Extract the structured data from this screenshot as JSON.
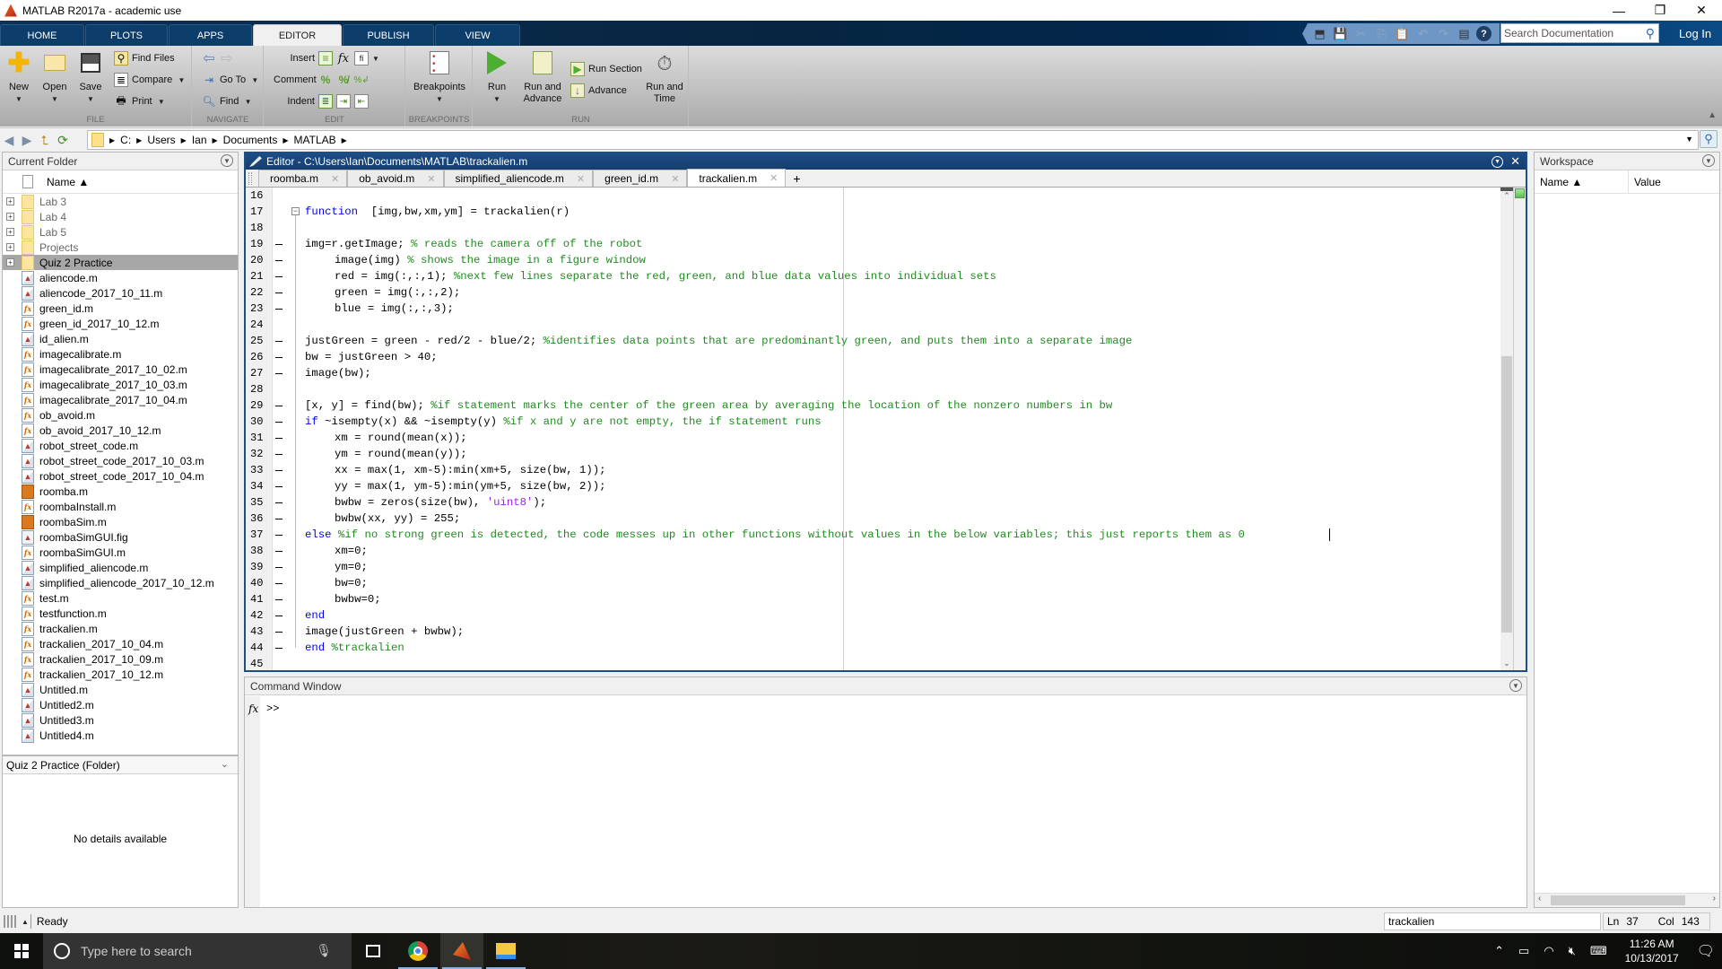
{
  "window": {
    "title": "MATLAB R2017a - academic use",
    "controls": {
      "minimize": "—",
      "restore": "❐",
      "close": "✕"
    }
  },
  "ribbon_tabs": [
    {
      "label": "HOME",
      "active": false
    },
    {
      "label": "PLOTS",
      "active": false
    },
    {
      "label": "APPS",
      "active": false
    },
    {
      "label": "EDITOR",
      "active": true
    },
    {
      "label": "PUBLISH",
      "active": false
    },
    {
      "label": "VIEW",
      "active": false
    }
  ],
  "quick_access": {
    "icons": [
      "new-simulink-icon",
      "save-icon",
      "cut-icon",
      "copy-icon",
      "paste-icon",
      "undo-icon",
      "redo-icon",
      "switch-windows-icon",
      "help-icon"
    ],
    "search_placeholder": "Search Documentation",
    "login_label": "Log In"
  },
  "ribbon": {
    "file": {
      "group_label": "FILE",
      "new": "New",
      "open": "Open",
      "save": "Save",
      "find_files": "Find Files",
      "compare": "Compare",
      "print": "Print"
    },
    "navigate": {
      "group_label": "NAVIGATE",
      "goto": "Go To",
      "find": "Find"
    },
    "edit": {
      "group_label": "EDIT",
      "insert": "Insert",
      "comment": "Comment",
      "indent": "Indent"
    },
    "breakpoints": {
      "group_label": "BREAKPOINTS",
      "breakpoints": "Breakpoints"
    },
    "run": {
      "group_label": "RUN",
      "run": "Run",
      "run_and_advance_1": "Run and",
      "run_and_advance_2": "Advance",
      "run_section": "Run Section",
      "advance": "Advance",
      "run_and_time_1": "Run and",
      "run_and_time_2": "Time"
    }
  },
  "address_bar": {
    "path": [
      "C:",
      "Users",
      "Ian",
      "Documents",
      "MATLAB"
    ]
  },
  "current_folder": {
    "title": "Current Folder",
    "column_name": "Name ▲",
    "items": [
      {
        "name": "Lab 3",
        "type": "folder"
      },
      {
        "name": "Lab 4",
        "type": "folder"
      },
      {
        "name": "Lab 5",
        "type": "folder"
      },
      {
        "name": "Projects",
        "type": "folder"
      },
      {
        "name": "Quiz 2 Practice",
        "type": "folder",
        "selected": true
      },
      {
        "name": "aliencode.m",
        "type": "script"
      },
      {
        "name": "aliencode_2017_10_11.m",
        "type": "script"
      },
      {
        "name": "green_id.m",
        "type": "function"
      },
      {
        "name": "green_id_2017_10_12.m",
        "type": "function"
      },
      {
        "name": "id_alien.m",
        "type": "script"
      },
      {
        "name": "imagecalibrate.m",
        "type": "function"
      },
      {
        "name": "imagecalibrate_2017_10_02.m",
        "type": "function"
      },
      {
        "name": "imagecalibrate_2017_10_03.m",
        "type": "function"
      },
      {
        "name": "imagecalibrate_2017_10_04.m",
        "type": "function"
      },
      {
        "name": "ob_avoid.m",
        "type": "function"
      },
      {
        "name": "ob_avoid_2017_10_12.m",
        "type": "function"
      },
      {
        "name": "robot_street_code.m",
        "type": "script"
      },
      {
        "name": "robot_street_code_2017_10_03.m",
        "type": "script"
      },
      {
        "name": "robot_street_code_2017_10_04.m",
        "type": "script"
      },
      {
        "name": "roomba.m",
        "type": "class"
      },
      {
        "name": "roombaInstall.m",
        "type": "function"
      },
      {
        "name": "roombaSim.m",
        "type": "class"
      },
      {
        "name": "roombaSimGUI.fig",
        "type": "figure"
      },
      {
        "name": "roombaSimGUI.m",
        "type": "function"
      },
      {
        "name": "simplified_aliencode.m",
        "type": "script"
      },
      {
        "name": "simplified_aliencode_2017_10_12.m",
        "type": "script"
      },
      {
        "name": "test.m",
        "type": "function"
      },
      {
        "name": "testfunction.m",
        "type": "function"
      },
      {
        "name": "trackalien.m",
        "type": "function"
      },
      {
        "name": "trackalien_2017_10_04.m",
        "type": "function"
      },
      {
        "name": "trackalien_2017_10_09.m",
        "type": "function"
      },
      {
        "name": "trackalien_2017_10_12.m",
        "type": "function"
      },
      {
        "name": "Untitled.m",
        "type": "script"
      },
      {
        "name": "Untitled2.m",
        "type": "script"
      },
      {
        "name": "Untitled3.m",
        "type": "script"
      },
      {
        "name": "Untitled4.m",
        "type": "script"
      }
    ],
    "details_title": "Quiz 2 Practice  (Folder)",
    "details_text": "No details available"
  },
  "editor": {
    "title": "Editor - C:\\Users\\Ian\\Documents\\MATLAB\\trackalien.m",
    "tabs": [
      {
        "label": "roomba.m",
        "active": false
      },
      {
        "label": "ob_avoid.m",
        "active": false
      },
      {
        "label": "simplified_aliencode.m",
        "active": false
      },
      {
        "label": "green_id.m",
        "active": false
      },
      {
        "label": "trackalien.m",
        "active": true
      }
    ],
    "new_tab_label": "+",
    "lines": [
      {
        "n": "16",
        "exec": false,
        "indent": 0,
        "tokens": []
      },
      {
        "n": "17",
        "exec": false,
        "indent": 0,
        "tokens": [
          [
            "kw",
            "function"
          ],
          [
            "",
            "  [img,bw,xm,ym] = trackalien(r)"
          ]
        ]
      },
      {
        "n": "18",
        "exec": false,
        "indent": 0,
        "tokens": []
      },
      {
        "n": "19",
        "exec": true,
        "indent": 0,
        "tokens": [
          [
            "",
            "img=r.getImage; "
          ],
          [
            "cm",
            "% reads the camera off of the robot"
          ]
        ]
      },
      {
        "n": "20",
        "exec": true,
        "indent": 1,
        "tokens": [
          [
            "",
            "image(img) "
          ],
          [
            "cm",
            "% shows the image in a figure window"
          ]
        ]
      },
      {
        "n": "21",
        "exec": true,
        "indent": 1,
        "tokens": [
          [
            "",
            "red = img(:,:,1); "
          ],
          [
            "cm",
            "%next few lines separate the red, green, and blue data values into individual sets"
          ]
        ]
      },
      {
        "n": "22",
        "exec": true,
        "indent": 1,
        "tokens": [
          [
            "",
            "green = img(:,:,2);"
          ]
        ]
      },
      {
        "n": "23",
        "exec": true,
        "indent": 1,
        "tokens": [
          [
            "",
            "blue = img(:,:,3);"
          ]
        ]
      },
      {
        "n": "24",
        "exec": false,
        "indent": 0,
        "tokens": []
      },
      {
        "n": "25",
        "exec": true,
        "indent": 0,
        "tokens": [
          [
            "",
            "justGreen = green - red/2 - blue/2; "
          ],
          [
            "cm",
            "%identifies data points that are predominantly green, and puts them into a separate image"
          ]
        ]
      },
      {
        "n": "26",
        "exec": true,
        "indent": 0,
        "tokens": [
          [
            "",
            "bw = justGreen > 40;"
          ]
        ]
      },
      {
        "n": "27",
        "exec": true,
        "indent": 0,
        "tokens": [
          [
            "",
            "image(bw);"
          ]
        ]
      },
      {
        "n": "28",
        "exec": false,
        "indent": 0,
        "tokens": []
      },
      {
        "n": "29",
        "exec": true,
        "indent": 0,
        "tokens": [
          [
            "",
            "[x, y] = find(bw); "
          ],
          [
            "cm",
            "%if statement marks the center of the green area by averaging the location of the nonzero numbers in bw"
          ]
        ]
      },
      {
        "n": "30",
        "exec": true,
        "indent": 0,
        "tokens": [
          [
            "kw",
            "if"
          ],
          [
            "",
            " ~isempty(x) && ~isempty(y) "
          ],
          [
            "cm",
            "%if x and y are not empty, the if statement runs"
          ]
        ]
      },
      {
        "n": "31",
        "exec": true,
        "indent": 1,
        "tokens": [
          [
            "",
            "xm = round(mean(x));"
          ]
        ]
      },
      {
        "n": "32",
        "exec": true,
        "indent": 1,
        "tokens": [
          [
            "",
            "ym = round(mean(y));"
          ]
        ]
      },
      {
        "n": "33",
        "exec": true,
        "indent": 1,
        "tokens": [
          [
            "",
            "xx = max(1, xm-5):min(xm+5, size(bw, 1));"
          ]
        ]
      },
      {
        "n": "34",
        "exec": true,
        "indent": 1,
        "tokens": [
          [
            "",
            "yy = max(1, ym-5):min(ym+5, size(bw, 2));"
          ]
        ]
      },
      {
        "n": "35",
        "exec": true,
        "indent": 1,
        "tokens": [
          [
            "",
            "bwbw = zeros(size(bw), "
          ],
          [
            "st",
            "'uint8'"
          ],
          [
            "",
            ");"
          ]
        ]
      },
      {
        "n": "36",
        "exec": true,
        "indent": 1,
        "tokens": [
          [
            "",
            "bwbw(xx, yy) = 255;"
          ]
        ]
      },
      {
        "n": "37",
        "exec": true,
        "indent": 0,
        "tokens": [
          [
            "kw",
            "else"
          ],
          [
            "",
            " "
          ],
          [
            "cm",
            "%if no strong green is detected, the code messes up in other functions without values in the below variables; this just reports them as 0"
          ]
        ]
      },
      {
        "n": "38",
        "exec": true,
        "indent": 1,
        "tokens": [
          [
            "",
            "xm=0;"
          ]
        ]
      },
      {
        "n": "39",
        "exec": true,
        "indent": 1,
        "tokens": [
          [
            "",
            "ym=0;"
          ]
        ]
      },
      {
        "n": "40",
        "exec": true,
        "indent": 1,
        "tokens": [
          [
            "",
            "bw=0;"
          ]
        ]
      },
      {
        "n": "41",
        "exec": true,
        "indent": 1,
        "tokens": [
          [
            "",
            "bwbw=0;"
          ]
        ]
      },
      {
        "n": "42",
        "exec": true,
        "indent": 0,
        "tokens": [
          [
            "kw",
            "end"
          ]
        ]
      },
      {
        "n": "43",
        "exec": true,
        "indent": 0,
        "tokens": [
          [
            "",
            "image(justGreen + bwbw);"
          ]
        ]
      },
      {
        "n": "44",
        "exec": true,
        "indent": 0,
        "tokens": [
          [
            "kw",
            "end"
          ],
          [
            "",
            " "
          ],
          [
            "cm",
            "%trackalien"
          ]
        ]
      },
      {
        "n": "45",
        "exec": false,
        "indent": 0,
        "tokens": []
      }
    ]
  },
  "command_window": {
    "title": "Command Window",
    "fx": "fx",
    "prompt": ">>"
  },
  "workspace": {
    "title": "Workspace",
    "col_name": "Name ▲",
    "col_value": "Value"
  },
  "status_bar": {
    "status": "Ready",
    "function_name": "trackalien",
    "ln_label": "Ln",
    "ln": "37",
    "col_label": "Col",
    "col": "143"
  },
  "taskbar": {
    "search_placeholder": "Type here to search",
    "time": "11:26 AM",
    "date": "10/13/2017"
  }
}
